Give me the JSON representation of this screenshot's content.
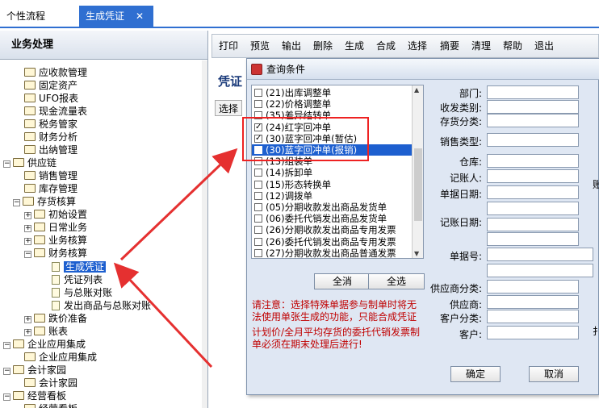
{
  "tabs": [
    {
      "label": "个性流程"
    },
    {
      "label": "生成凭证",
      "close": "✕"
    }
  ],
  "nav": {
    "title": "业务处理",
    "items": [
      {
        "label": "应收款管理",
        "kind": "doc",
        "exp": ""
      },
      {
        "label": "固定资产",
        "kind": "doc",
        "exp": ""
      },
      {
        "label": "UFO报表",
        "kind": "doc",
        "exp": ""
      },
      {
        "label": "现金流量表",
        "kind": "doc",
        "exp": ""
      },
      {
        "label": "税务管家",
        "kind": "doc",
        "exp": ""
      },
      {
        "label": "财务分析",
        "kind": "doc",
        "exp": ""
      },
      {
        "label": "出纳管理",
        "kind": "doc",
        "exp": ""
      },
      {
        "label": "供应链",
        "kind": "folder",
        "exp": "−"
      },
      {
        "label": "销售管理",
        "kind": "doc",
        "exp": ""
      },
      {
        "label": "库存管理",
        "kind": "doc",
        "exp": ""
      },
      {
        "label": "存货核算",
        "kind": "folder",
        "exp": "−"
      },
      {
        "label": "初始设置",
        "kind": "folder",
        "exp": "+"
      },
      {
        "label": "日常业务",
        "kind": "folder",
        "exp": "+"
      },
      {
        "label": "业务核算",
        "kind": "folder",
        "exp": "+"
      },
      {
        "label": "财务核算",
        "kind": "folder",
        "exp": "−"
      },
      {
        "label": "生成凭证",
        "kind": "file",
        "exp": "",
        "selected": true
      },
      {
        "label": "凭证列表",
        "kind": "file",
        "exp": ""
      },
      {
        "label": "与总账对账",
        "kind": "file",
        "exp": ""
      },
      {
        "label": "发出商品与总账对账",
        "kind": "file",
        "exp": ""
      },
      {
        "label": "跌价准备",
        "kind": "folder",
        "exp": "+"
      },
      {
        "label": "账表",
        "kind": "folder",
        "exp": "+"
      },
      {
        "label": "企业应用集成",
        "kind": "folder",
        "exp": "−"
      },
      {
        "label": "企业应用集成",
        "kind": "doc",
        "exp": ""
      },
      {
        "label": "会计家园",
        "kind": "folder",
        "exp": "−"
      },
      {
        "label": "会计家园",
        "kind": "doc",
        "exp": ""
      },
      {
        "label": "经营看板",
        "kind": "folder",
        "exp": "−"
      },
      {
        "label": "经营看板",
        "kind": "doc",
        "exp": ""
      }
    ]
  },
  "toolbar": [
    "打印",
    "预览",
    "输出",
    "删除",
    "生成",
    "合成",
    "选择",
    "摘要",
    "清理",
    "帮助",
    "退出"
  ],
  "main": {
    "title": "凭证",
    "select_label": "选择"
  },
  "dialog": {
    "title": "查询条件",
    "list": [
      {
        "label": "(21)出库调整单",
        "checked": false
      },
      {
        "label": "(22)价格调整单",
        "checked": false
      },
      {
        "label": "(35)差异结转单",
        "checked": false
      },
      {
        "label": "(24)红字回冲单",
        "checked": true
      },
      {
        "label": "(30)蓝字回冲单(暂估)",
        "checked": true
      },
      {
        "label": "(30)蓝字回冲单(报销)",
        "checked": true,
        "highlight": true
      },
      {
        "label": "(13)组装单",
        "checked": false
      },
      {
        "label": "(14)拆卸单",
        "checked": false
      },
      {
        "label": "(15)形态转换单",
        "checked": false
      },
      {
        "label": "(12)调拨单",
        "checked": false
      },
      {
        "label": "(05)分期收款发出商品发货单",
        "checked": false
      },
      {
        "label": "(06)委托代销发出商品发货单",
        "checked": false
      },
      {
        "label": "(26)分期收款发出商品专用发票",
        "checked": false
      },
      {
        "label": "(26)委托代销发出商品专用发票",
        "checked": false
      },
      {
        "label": "(27)分期收款发出商品普通发票",
        "checked": false
      }
    ],
    "clear_all": "全消",
    "select_all": "全选",
    "note1": "请注意：选择特殊单据参与制单时将无法使用单张生成的功能，只能合成凭证",
    "note2": "计划价/全月平均存货的委托代销发票制单必须在期末处理后进行!",
    "fields": [
      {
        "label": "部门:"
      },
      {
        "label": "收发类别:"
      },
      {
        "label": "存货分类:"
      },
      {
        "label": "销售类型:"
      },
      {
        "label": "仓库:"
      },
      {
        "label": "记账人:"
      },
      {
        "label": "单据日期:"
      },
      {
        "label": "记账日期:"
      },
      {
        "label": "单据号:"
      },
      {
        "label": "供应商分类:"
      },
      {
        "label": "供应商:"
      },
      {
        "label": "客户分类:"
      },
      {
        "label": "客户:"
      }
    ],
    "ok": "确定",
    "cancel": "取消",
    "clip_right_1": "账",
    "clip_right_2": "扌"
  }
}
